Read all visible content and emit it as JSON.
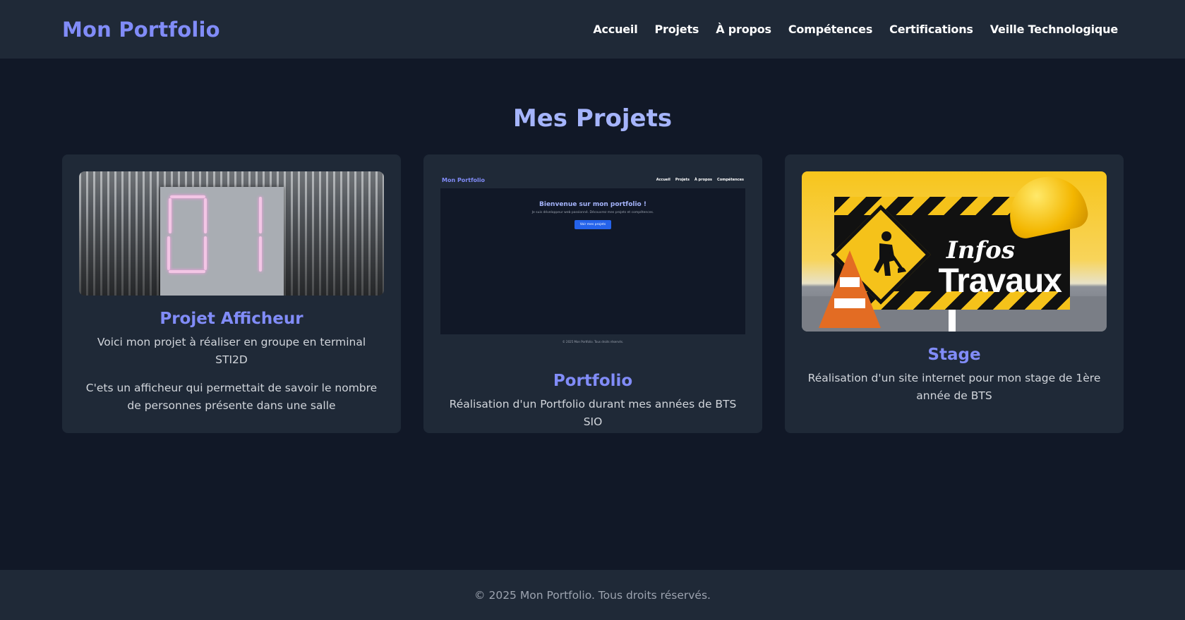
{
  "header": {
    "brand": "Mon Portfolio",
    "nav": [
      "Accueil",
      "Projets",
      "À propos",
      "Compétences",
      "Certifications",
      "Veille Technologique"
    ]
  },
  "main": {
    "title": "Mes Projets",
    "projects": [
      {
        "title": "Projet Afficheur",
        "paragraphs": [
          "Voici mon projet à réaliser en groupe en terminal STI2D",
          "C'ets un afficheur qui permettait de savoir le nombre de personnes présente dans une salle"
        ],
        "image": "photo d'un afficheur 7 segments \"01\" suspendu au plafond"
      },
      {
        "title": "Portfolio",
        "paragraphs": [
          "Réalisation d'un Portfolio durant mes années de BTS SIO"
        ],
        "image": "capture d'écran du portfolio",
        "preview": {
          "brand": "Mon Portfolio",
          "nav": [
            "Accueil",
            "Projets",
            "À propos",
            "Compétences"
          ],
          "title": "Bienvenue sur mon portfolio !",
          "subtitle": "Je suis développeur web passionné. Découvrez mes projets et compétences.",
          "button": "Voir mes projets",
          "footer": "© 2025 Mon Portfolio. Tous droits réservés."
        }
      },
      {
        "title": "Stage",
        "paragraphs": [
          "Réalisation d'un site internet pour mon stage de 1ère année de BTS"
        ],
        "image": "illustration panneau Infos Travaux",
        "image_text": [
          "Infos",
          "Travaux"
        ]
      }
    ]
  },
  "footer": {
    "text": "© 2025 Mon Portfolio. Tous droits réservés."
  },
  "colors": {
    "background": "#111827",
    "surface": "#1f2937",
    "accent": "#818cf8",
    "title": "#a5b4fc",
    "text": "#d1d5db",
    "muted": "#9ca3af"
  }
}
